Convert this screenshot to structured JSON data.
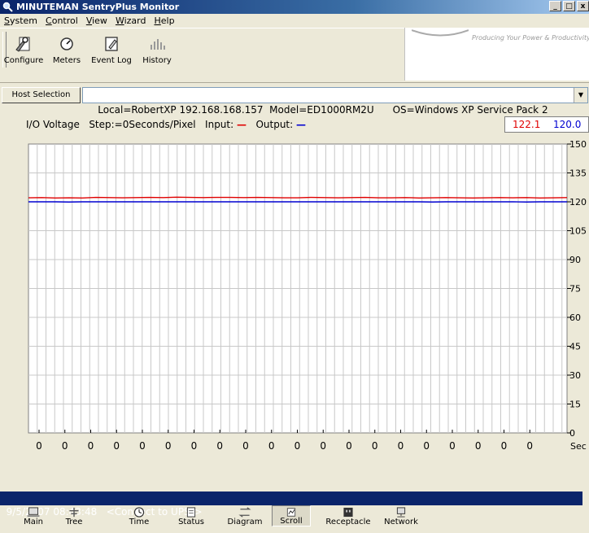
{
  "window": {
    "title": "MINUTEMAN SentryPlus Monitor",
    "buttons": [
      "_",
      "□",
      "x"
    ]
  },
  "menu": [
    {
      "label": "System"
    },
    {
      "label": "Control"
    },
    {
      "label": "View"
    },
    {
      "label": "Wizard"
    },
    {
      "label": "Help"
    }
  ],
  "toolbar": {
    "configure": "Configure",
    "meters": "Meters",
    "event_log": "Event Log",
    "history": "History"
  },
  "logo": {
    "tagline": "Producing Your Power & Productivity"
  },
  "host": {
    "button": "Host Selection",
    "selection": "Local=RobertXP 192.168.168.157  Model=ED1000RM2U      OS=Windows XP Service Pack 2"
  },
  "chart_header": {
    "title": "I/O Voltage",
    "step": "Step:=0Seconds/Pixel",
    "input_label": "Input:",
    "output_label": "Output:",
    "input_value": "122.1",
    "output_value": "120.0",
    "input_color": "#e00000",
    "output_color": "#0000d0"
  },
  "chart_data": {
    "type": "line",
    "title": "I/O Voltage",
    "ylim": [
      0,
      150
    ],
    "y_ticks": [
      "150",
      "135",
      "120",
      "105",
      "90",
      "75",
      "60",
      "45",
      "30",
      "15",
      "0"
    ],
    "x_ticks": [
      "0",
      "0",
      "0",
      "0",
      "0",
      "0",
      "0",
      "0",
      "0",
      "0",
      "0",
      "0",
      "0",
      "0",
      "0",
      "0",
      "0",
      "0",
      "0",
      "0"
    ],
    "x_unit": "Sec",
    "series": [
      {
        "name": "Input",
        "color": "#e00000",
        "values": [
          122.1,
          122.2,
          122,
          122.1,
          122,
          122.3,
          122.2,
          122.1,
          122.2,
          122.3,
          122.2,
          122.4,
          122.3,
          122.2,
          122.3,
          122.3,
          122.2,
          122.3,
          122.2,
          122.1,
          122.1,
          122.3,
          122.2,
          122.1,
          122.2,
          122.3,
          122.1,
          122.1,
          122.2,
          122,
          122.1,
          122.2,
          122.1,
          122,
          122.1,
          122.2,
          122.1,
          122.2,
          122,
          122.1,
          122.2
        ]
      },
      {
        "name": "Output",
        "color": "#0000d0",
        "values": [
          120,
          120,
          120,
          119.9,
          120,
          120,
          120,
          120,
          120,
          120,
          120,
          120,
          120,
          120,
          120,
          120,
          120,
          120,
          120,
          120,
          120,
          120,
          120,
          120,
          120,
          120,
          120,
          120,
          120,
          120,
          119.9,
          120,
          120,
          120,
          120,
          120,
          120,
          119.9,
          120,
          120,
          120
        ]
      }
    ]
  },
  "status": {
    "text": "9/5/2007 08:43:48   <Connect to UPS!>"
  },
  "bottom_tabs": [
    {
      "label": "Main"
    },
    {
      "label": "Tree"
    },
    {
      "label": "Time"
    },
    {
      "label": "Status"
    },
    {
      "label": "Diagram"
    },
    {
      "label": "Scroll"
    },
    {
      "label": "Receptacle"
    },
    {
      "label": "Network"
    }
  ]
}
